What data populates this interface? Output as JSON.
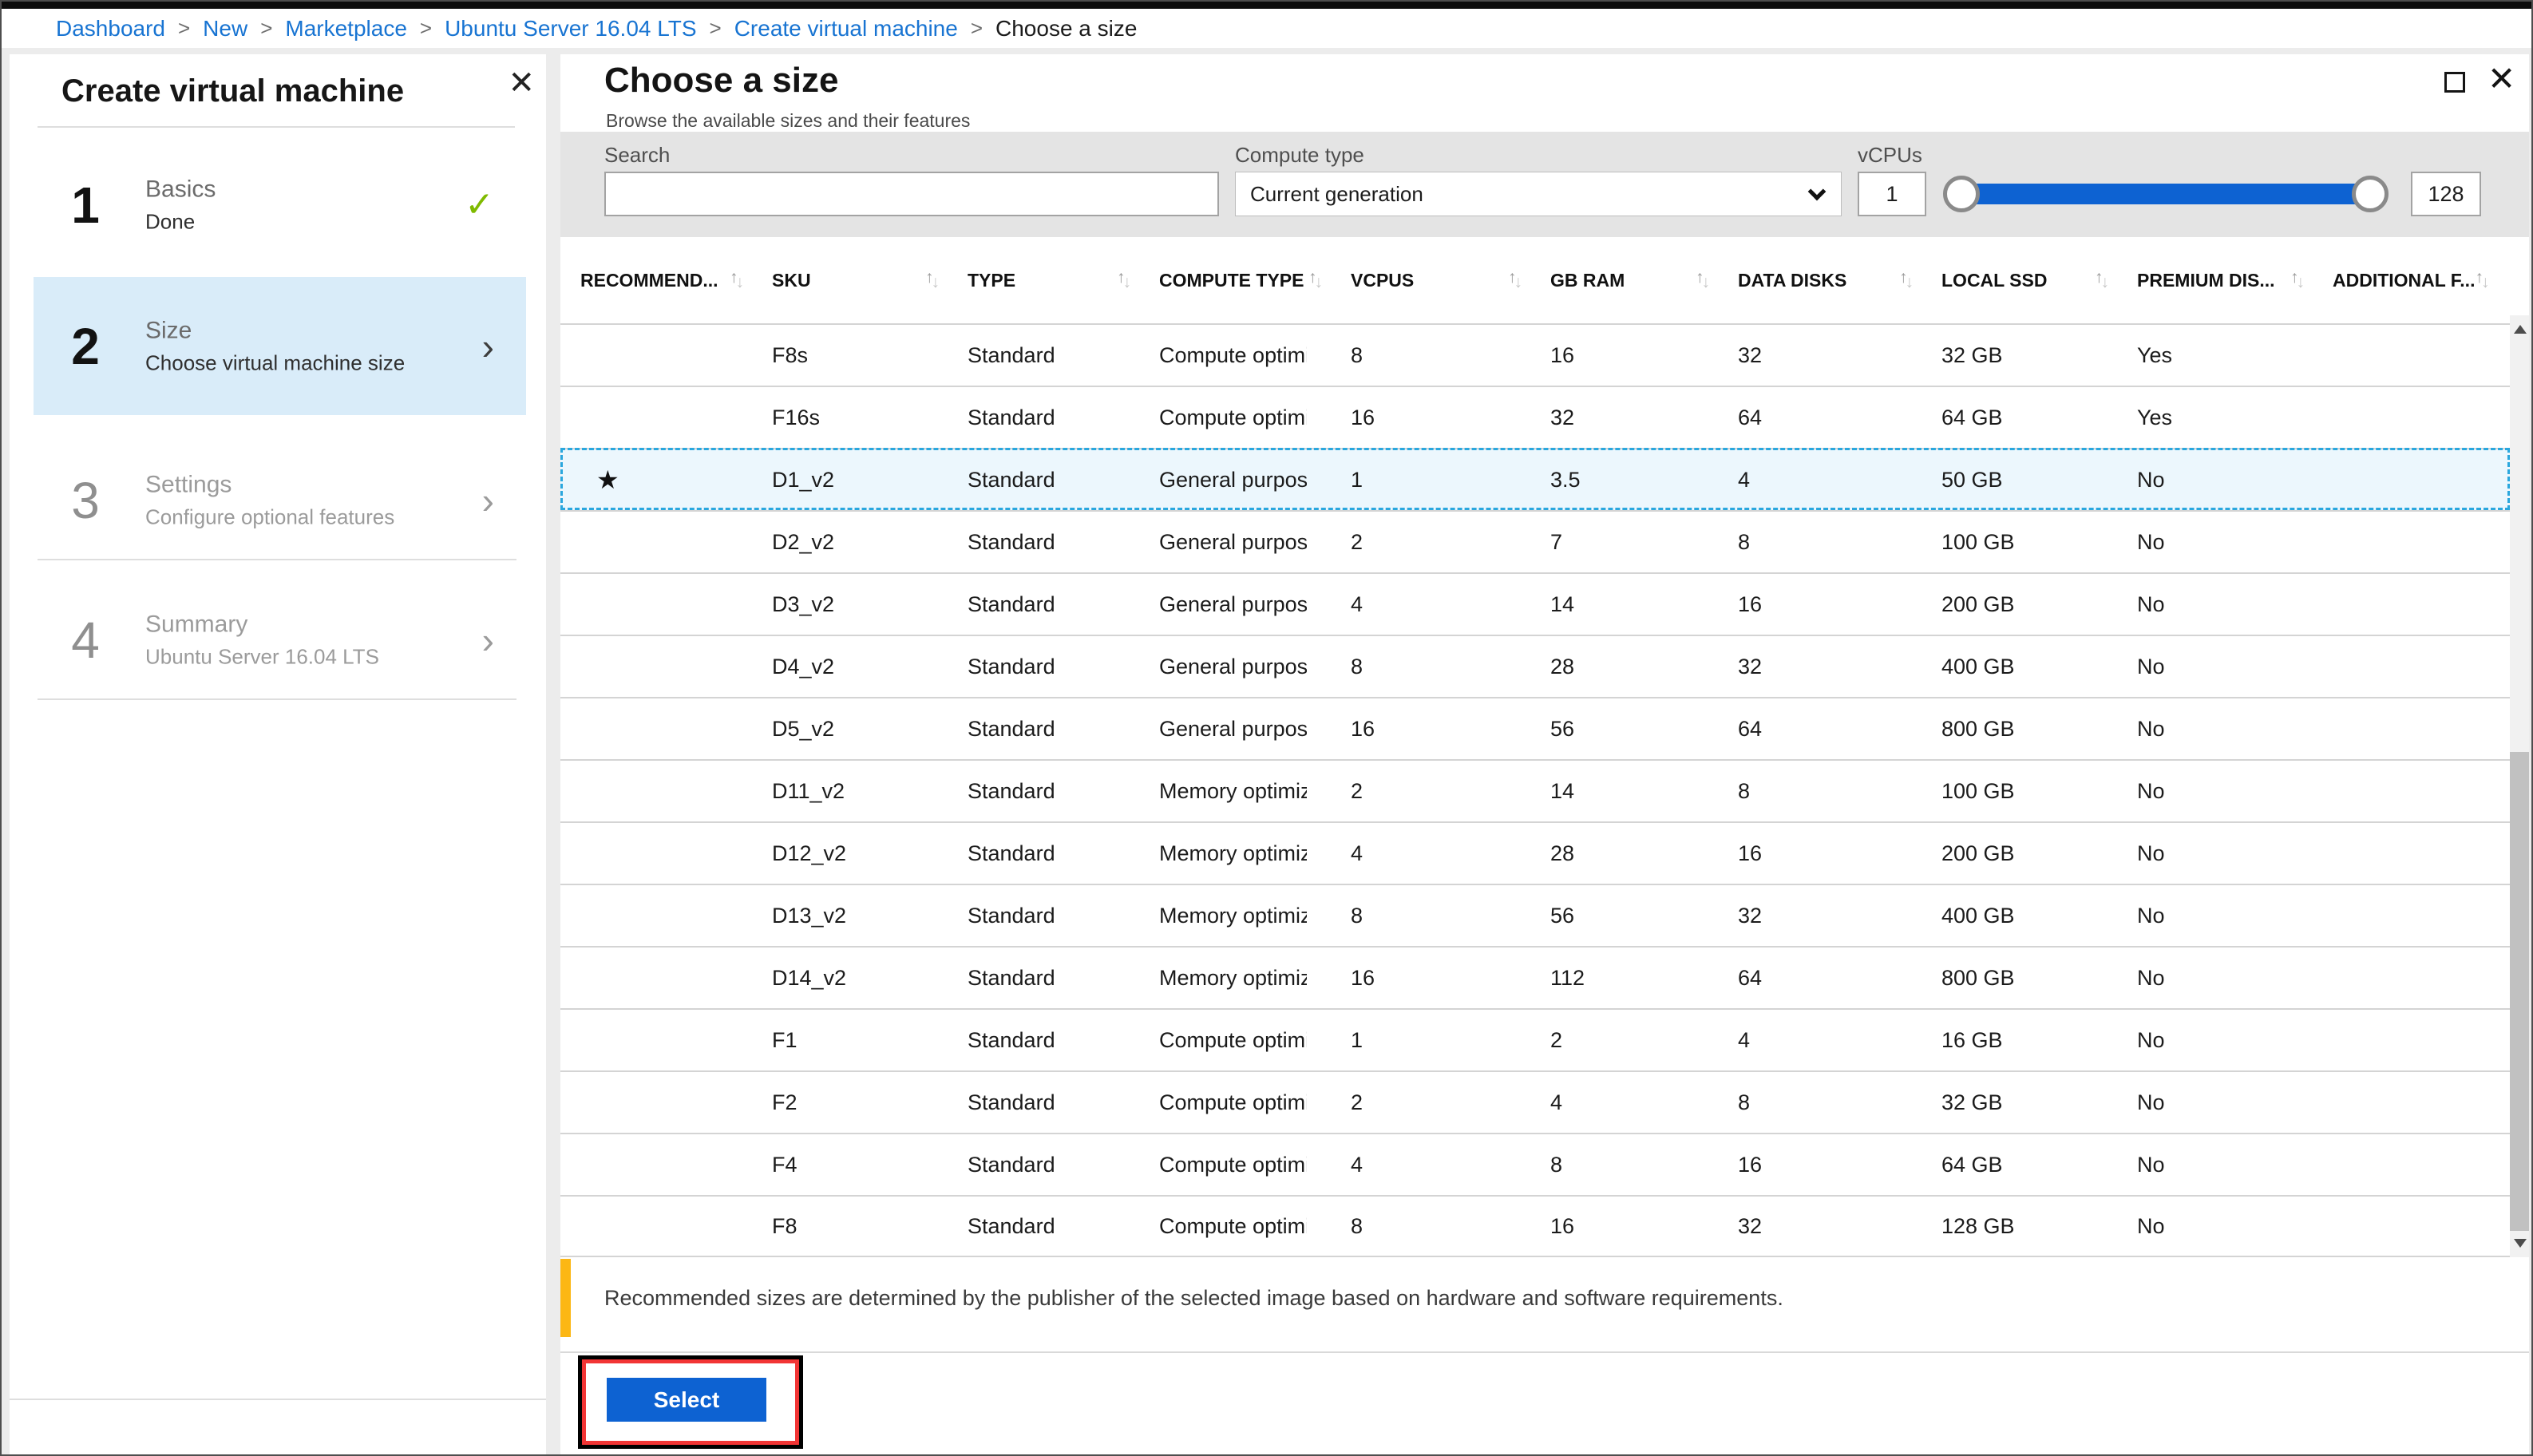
{
  "colors": {
    "accent_blue": "#0d62d2",
    "link_blue": "#1874d2",
    "step_active_bg": "#d9ecf9",
    "selected_row_bg": "#ecf7fd",
    "selected_row_border": "#2aa7de",
    "check_green": "#7fba00",
    "warning_yellow": "#fcb714",
    "annotation_red": "#f23535",
    "annotation_black": "#000000"
  },
  "breadcrumb": {
    "separator": ">",
    "items": [
      {
        "label": "Dashboard",
        "current": false
      },
      {
        "label": "New",
        "current": false
      },
      {
        "label": "Marketplace",
        "current": false
      },
      {
        "label": "Ubuntu Server 16.04 LTS",
        "current": false
      },
      {
        "label": "Create virtual machine",
        "current": false
      },
      {
        "label": "Choose a size",
        "current": true
      }
    ]
  },
  "left_panel": {
    "title": "Create virtual machine",
    "close_glyph": "✕",
    "check_glyph": "✓",
    "chevron_glyph": "›",
    "steps": [
      {
        "number": "1",
        "label": "Basics",
        "sublabel": "Done",
        "status": "done",
        "icon": "check"
      },
      {
        "number": "2",
        "label": "Size",
        "sublabel": "Choose virtual machine size",
        "status": "active",
        "icon": "chevron"
      },
      {
        "number": "3",
        "label": "Settings",
        "sublabel": "Configure optional features",
        "status": "upcoming",
        "icon": "chevron"
      },
      {
        "number": "4",
        "label": "Summary",
        "sublabel": "Ubuntu Server 16.04 LTS",
        "status": "upcoming",
        "icon": "chevron"
      }
    ]
  },
  "right_panel": {
    "title": "Choose a size",
    "subtitle": "Browse the available sizes and their features",
    "close_glyph": "✕",
    "filters": {
      "search_label": "Search",
      "search_value": "",
      "compute_type_label": "Compute type",
      "compute_type_value": "Current generation",
      "vcpus_label": "vCPUs",
      "vcpus_min": "1",
      "vcpus_max": "128"
    },
    "table": {
      "star_glyph": "★",
      "sort_icon": {
        "up": "↑",
        "down": "↓"
      },
      "columns": [
        {
          "key": "recommended",
          "label": "RECOMMEND..."
        },
        {
          "key": "sku",
          "label": "SKU"
        },
        {
          "key": "type",
          "label": "TYPE"
        },
        {
          "key": "compute-type",
          "label": "COMPUTE TYPE"
        },
        {
          "key": "vcpus",
          "label": "VCPUS"
        },
        {
          "key": "gb-ram",
          "label": "GB RAM"
        },
        {
          "key": "data-disks",
          "label": "DATA DISKS"
        },
        {
          "key": "local-ssd",
          "label": "LOCAL SSD"
        },
        {
          "key": "premium-disk",
          "label": "PREMIUM DIS..."
        },
        {
          "key": "additional-features",
          "label": "ADDITIONAL F..."
        }
      ],
      "rows": [
        {
          "recommended": false,
          "sku": "F8s",
          "type": "Standard",
          "compute_type": "Compute optimized",
          "vcpus": "8",
          "gb_ram": "16",
          "data_disks": "32",
          "local_ssd": "32 GB",
          "premium_disk": "Yes",
          "additional": "",
          "selected": false
        },
        {
          "recommended": false,
          "sku": "F16s",
          "type": "Standard",
          "compute_type": "Compute optimized",
          "vcpus": "16",
          "gb_ram": "32",
          "data_disks": "64",
          "local_ssd": "64 GB",
          "premium_disk": "Yes",
          "additional": "",
          "selected": false
        },
        {
          "recommended": true,
          "sku": "D1_v2",
          "type": "Standard",
          "compute_type": "General purpose",
          "vcpus": "1",
          "gb_ram": "3.5",
          "data_disks": "4",
          "local_ssd": "50 GB",
          "premium_disk": "No",
          "additional": "",
          "selected": true
        },
        {
          "recommended": false,
          "sku": "D2_v2",
          "type": "Standard",
          "compute_type": "General purpose",
          "vcpus": "2",
          "gb_ram": "7",
          "data_disks": "8",
          "local_ssd": "100 GB",
          "premium_disk": "No",
          "additional": "",
          "selected": false
        },
        {
          "recommended": false,
          "sku": "D3_v2",
          "type": "Standard",
          "compute_type": "General purpose",
          "vcpus": "4",
          "gb_ram": "14",
          "data_disks": "16",
          "local_ssd": "200 GB",
          "premium_disk": "No",
          "additional": "",
          "selected": false
        },
        {
          "recommended": false,
          "sku": "D4_v2",
          "type": "Standard",
          "compute_type": "General purpose",
          "vcpus": "8",
          "gb_ram": "28",
          "data_disks": "32",
          "local_ssd": "400 GB",
          "premium_disk": "No",
          "additional": "",
          "selected": false
        },
        {
          "recommended": false,
          "sku": "D5_v2",
          "type": "Standard",
          "compute_type": "General purpose",
          "vcpus": "16",
          "gb_ram": "56",
          "data_disks": "64",
          "local_ssd": "800 GB",
          "premium_disk": "No",
          "additional": "",
          "selected": false
        },
        {
          "recommended": false,
          "sku": "D11_v2",
          "type": "Standard",
          "compute_type": "Memory optimized",
          "vcpus": "2",
          "gb_ram": "14",
          "data_disks": "8",
          "local_ssd": "100 GB",
          "premium_disk": "No",
          "additional": "",
          "selected": false
        },
        {
          "recommended": false,
          "sku": "D12_v2",
          "type": "Standard",
          "compute_type": "Memory optimized",
          "vcpus": "4",
          "gb_ram": "28",
          "data_disks": "16",
          "local_ssd": "200 GB",
          "premium_disk": "No",
          "additional": "",
          "selected": false
        },
        {
          "recommended": false,
          "sku": "D13_v2",
          "type": "Standard",
          "compute_type": "Memory optimized",
          "vcpus": "8",
          "gb_ram": "56",
          "data_disks": "32",
          "local_ssd": "400 GB",
          "premium_disk": "No",
          "additional": "",
          "selected": false
        },
        {
          "recommended": false,
          "sku": "D14_v2",
          "type": "Standard",
          "compute_type": "Memory optimized",
          "vcpus": "16",
          "gb_ram": "112",
          "data_disks": "64",
          "local_ssd": "800 GB",
          "premium_disk": "No",
          "additional": "",
          "selected": false
        },
        {
          "recommended": false,
          "sku": "F1",
          "type": "Standard",
          "compute_type": "Compute optimized",
          "vcpus": "1",
          "gb_ram": "2",
          "data_disks": "4",
          "local_ssd": "16 GB",
          "premium_disk": "No",
          "additional": "",
          "selected": false
        },
        {
          "recommended": false,
          "sku": "F2",
          "type": "Standard",
          "compute_type": "Compute optimized",
          "vcpus": "2",
          "gb_ram": "4",
          "data_disks": "8",
          "local_ssd": "32 GB",
          "premium_disk": "No",
          "additional": "",
          "selected": false
        },
        {
          "recommended": false,
          "sku": "F4",
          "type": "Standard",
          "compute_type": "Compute optimized",
          "vcpus": "4",
          "gb_ram": "8",
          "data_disks": "16",
          "local_ssd": "64 GB",
          "premium_disk": "No",
          "additional": "",
          "selected": false
        },
        {
          "recommended": false,
          "sku": "F8",
          "type": "Standard",
          "compute_type": "Compute optimized",
          "vcpus": "8",
          "gb_ram": "16",
          "data_disks": "32",
          "local_ssd": "128 GB",
          "premium_disk": "No",
          "additional": "",
          "selected": false
        }
      ]
    },
    "note": "Recommended sizes are determined by the publisher of the selected image based on hardware and software requirements.",
    "select_button": "Select"
  }
}
